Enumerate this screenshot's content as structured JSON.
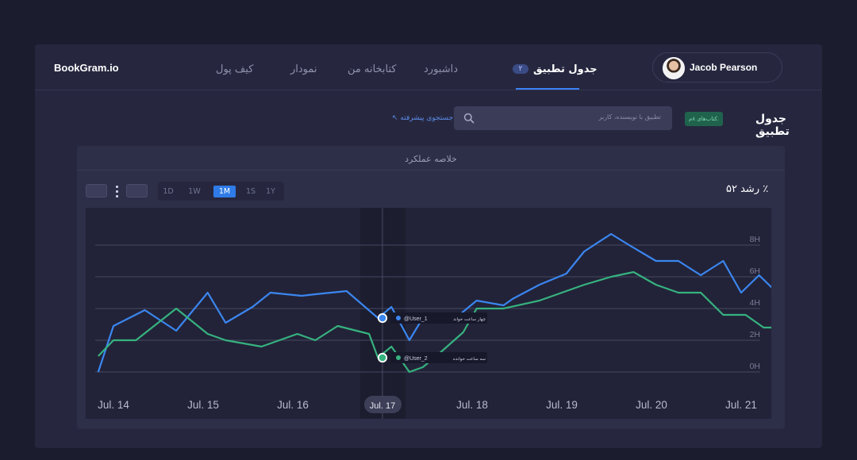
{
  "app": {
    "brand": "BookGram.io"
  },
  "nav": {
    "items": [
      {
        "label": "کیف پول",
        "active": false
      },
      {
        "label": "نمودار",
        "active": false
      },
      {
        "label": "کتابخانه من",
        "active": false
      },
      {
        "label": "داشبورد",
        "active": false
      },
      {
        "label": "جدول تطبیق",
        "active": true,
        "badge": "۲"
      }
    ]
  },
  "user": {
    "name": "Jacob Pearson"
  },
  "page": {
    "title": "جدول تطبیق",
    "badge": "کتاب‌های ۸م.",
    "search_placeholder": "تطبیق با نویسنده، کاربر",
    "advanced_search": "جستجوی پیشرفته"
  },
  "panel": {
    "title": "خلاصه عملکرد",
    "growth": "رشد ۵۲ ٪",
    "ranges": [
      "1D",
      "1W",
      "1M",
      "1S",
      "1Y"
    ],
    "active_range": "1M"
  },
  "colors": {
    "user1": "#3b86f0",
    "user2": "#36b27f",
    "accent": "#2f7be8"
  },
  "chart_data": {
    "type": "line",
    "x_labels": [
      "Jul. 14",
      "Jul. 15",
      "Jul. 16",
      "Jul. 17",
      "Jul. 18",
      "Jul. 19",
      "Jul. 20",
      "Jul. 21"
    ],
    "y_ticks": [
      "0H",
      "2H",
      "4H",
      "6H",
      "8H"
    ],
    "ylim": [
      0,
      8
    ],
    "xlim": [
      14,
      21
    ],
    "highlight_x": 17,
    "highlight_label": "Jul. 17",
    "grid": true,
    "series": [
      {
        "name": "@User_1",
        "tooltip_label": "چهار ساعت خواند",
        "x": [
          13.83,
          14.0,
          14.35,
          14.7,
          15.05,
          15.25,
          15.55,
          15.75,
          16.1,
          16.25,
          16.6,
          16.95,
          17.1,
          17.3,
          17.45,
          17.75,
          18.05,
          18.35,
          18.45,
          18.75,
          19.05,
          19.25,
          19.55,
          19.75,
          20.05,
          20.3,
          20.55,
          20.8,
          21.0,
          21.2,
          21.4,
          21.5,
          21.7,
          21.9,
          22.0
        ],
        "y": [
          0.0,
          2.9,
          3.9,
          2.6,
          5.0,
          3.1,
          4.1,
          5.0,
          4.8,
          4.9,
          5.1,
          3.4,
          4.1,
          2.0,
          3.4,
          3.1,
          4.5,
          4.2,
          4.6,
          5.5,
          6.2,
          7.6,
          8.7,
          8.0,
          7.0,
          7.0,
          6.1,
          7.0,
          5.0,
          6.1,
          5.0,
          7.1,
          5.5,
          6.1,
          6.1
        ]
      },
      {
        "name": "@User_2",
        "tooltip_label": "سه ساعت خوانده",
        "x": [
          13.83,
          14.0,
          14.25,
          14.7,
          15.05,
          15.25,
          15.65,
          16.05,
          16.25,
          16.5,
          16.85,
          16.95,
          17.1,
          17.3,
          17.45,
          17.6,
          17.9,
          18.05,
          18.35,
          18.75,
          19.05,
          19.25,
          19.55,
          19.8,
          20.05,
          20.3,
          20.55,
          20.8,
          21.05,
          21.25,
          21.5,
          21.75,
          21.9
        ],
        "y": [
          1.0,
          2.0,
          2.0,
          4.0,
          2.4,
          2.0,
          1.6,
          2.4,
          2.0,
          2.9,
          2.4,
          0.9,
          1.6,
          0.0,
          0.3,
          1.0,
          2.5,
          4.0,
          4.0,
          4.5,
          5.1,
          5.5,
          6.0,
          6.3,
          5.5,
          5.0,
          5.0,
          3.6,
          3.6,
          2.8,
          2.8,
          3.5,
          3.5
        ]
      }
    ]
  }
}
